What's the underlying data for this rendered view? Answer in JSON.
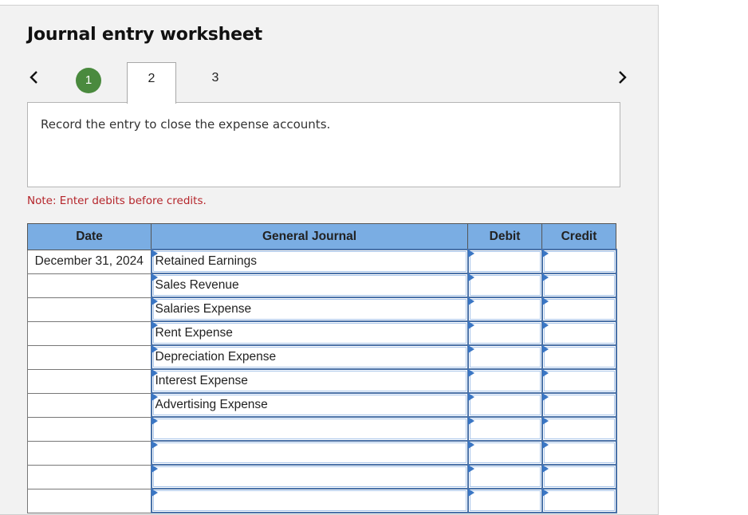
{
  "worksheet": {
    "title": "Journal entry worksheet",
    "steps": [
      {
        "label": "1",
        "state": "completed"
      },
      {
        "label": "2",
        "state": "active"
      },
      {
        "label": "3",
        "state": "pending"
      }
    ],
    "prev_icon": "chevron-left-icon",
    "next_icon": "chevron-right-icon",
    "instruction": "Record the entry to close the expense accounts.",
    "note": "Note: Enter debits before credits.",
    "colors": {
      "completed_step": "#4a8a3e",
      "header_bg": "#7aade3",
      "input_border": "#4a72a8",
      "note_text": "#b5252b"
    }
  },
  "journal": {
    "headers": [
      "Date",
      "General Journal",
      "Debit",
      "Credit"
    ],
    "rows": [
      {
        "date": "December 31, 2024",
        "account": "Retained Earnings",
        "debit": "",
        "credit": ""
      },
      {
        "date": "",
        "account": "Sales Revenue",
        "debit": "",
        "credit": ""
      },
      {
        "date": "",
        "account": "Salaries Expense",
        "debit": "",
        "credit": ""
      },
      {
        "date": "",
        "account": "Rent Expense",
        "debit": "",
        "credit": ""
      },
      {
        "date": "",
        "account": "Depreciation Expense",
        "debit": "",
        "credit": ""
      },
      {
        "date": "",
        "account": "Interest Expense",
        "debit": "",
        "credit": ""
      },
      {
        "date": "",
        "account": "Advertising Expense",
        "debit": "",
        "credit": ""
      },
      {
        "date": "",
        "account": "",
        "debit": "",
        "credit": ""
      },
      {
        "date": "",
        "account": "",
        "debit": "",
        "credit": ""
      },
      {
        "date": "",
        "account": "",
        "debit": "",
        "credit": ""
      },
      {
        "date": "",
        "account": "",
        "debit": "",
        "credit": ""
      }
    ]
  }
}
